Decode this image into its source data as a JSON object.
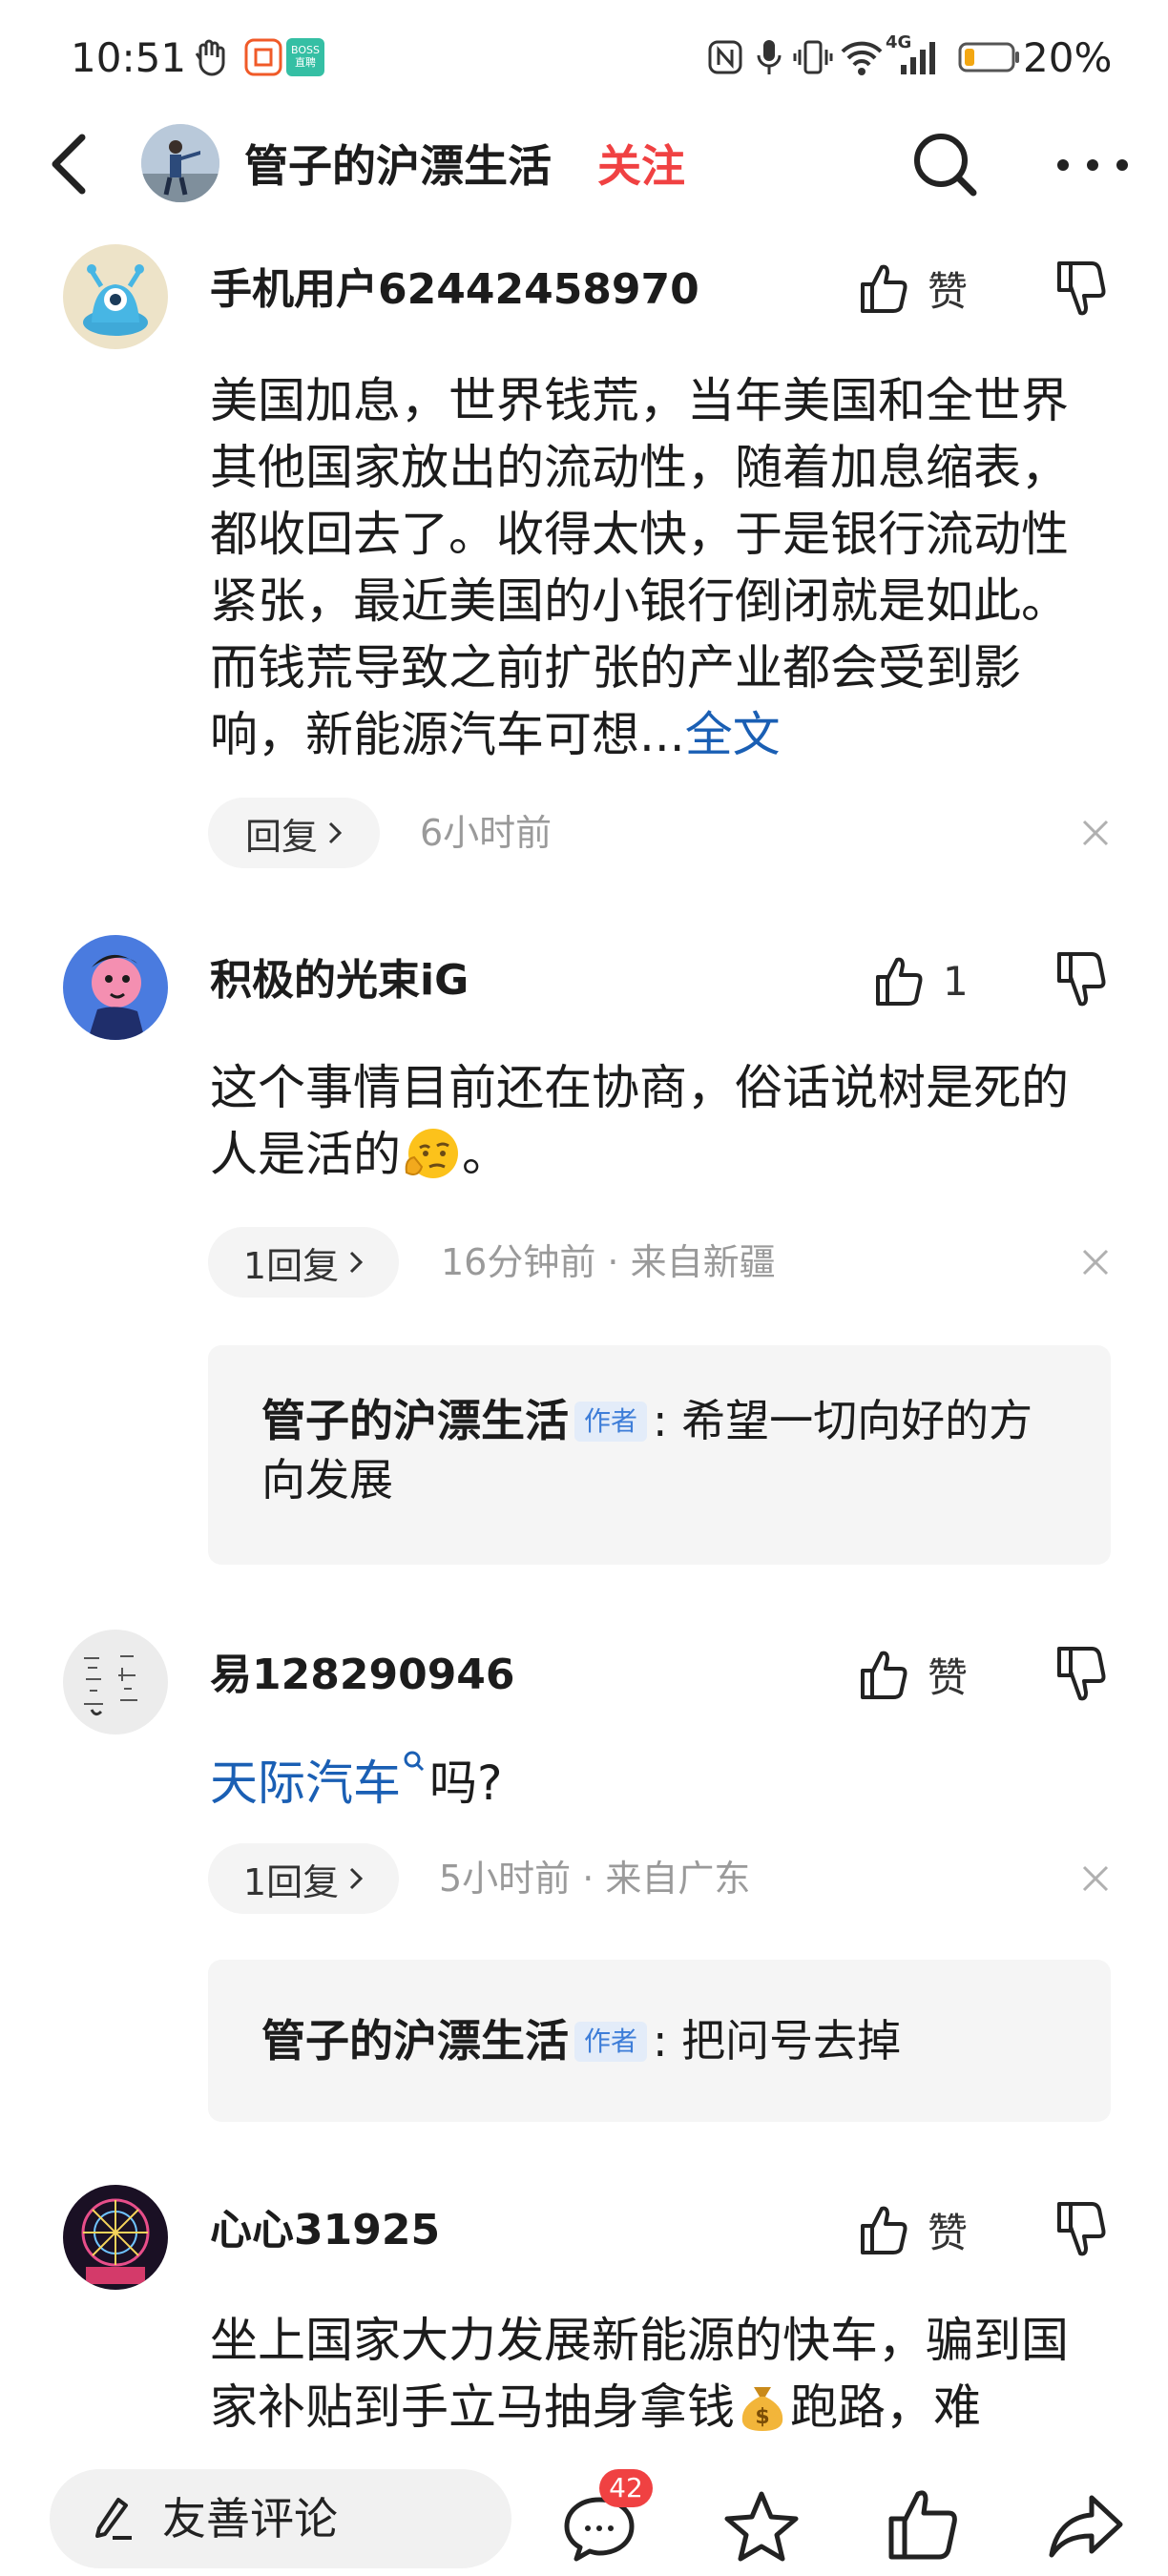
{
  "status_bar": {
    "time": "10:51",
    "icons": [
      "hand-icon",
      "dingding-icon",
      "boss-zhipin-icon",
      "nfc-icon",
      "mic-icon",
      "vibrate-icon",
      "wifi-icon",
      "signal-4g-icon",
      "battery-icon"
    ],
    "network": "4G",
    "battery": "20%",
    "boss_badge_top": "BOSS",
    "boss_badge_bottom": "直聘"
  },
  "header": {
    "title": "管子的沪漂生活",
    "follow_label": "关注"
  },
  "comments": [
    {
      "username": "手机用户62442458970",
      "like_label": "赞",
      "text": "美国加息，世界钱荒，当年美国和全世界其他国家放出的流动性，随着加息缩表，都收回去了。收得太快，于是银行流动性紧张，最近美国的小银行倒闭就是如此。而钱荒导致之前扩张的产业都会受到影响，新能源汽车可想...",
      "more_link": "全文",
      "reply_label": "回复",
      "meta": "6小时前"
    },
    {
      "username": "积极的光束iG",
      "like_label": "1",
      "text": "这个事情目前还在协商，俗话说树是死的人是活的",
      "text_end": "。",
      "reply_label": "1回复",
      "meta": "16分钟前 · 来自新疆",
      "reply": {
        "author": "管子的沪漂生活",
        "tag": "作者",
        "text": ": 希望一切向好的方向发展"
      }
    },
    {
      "username": "易128290946",
      "like_label": "赞",
      "text_link": "天际汽车",
      "text": "吗?",
      "reply_label": "1回复",
      "meta": "5小时前 · 来自广东",
      "reply": {
        "author": "管子的沪漂生活",
        "tag": "作者",
        "text": ": 把问号去掉"
      }
    },
    {
      "username": "心心31925",
      "like_label": "赞",
      "text": "坐上国家大力发展新能源的快车，骗到国家补贴到手立马抽身拿钱",
      "text_end": "跑路，难"
    }
  ],
  "bottom_bar": {
    "input_placeholder": "友善评论",
    "comment_count": "42"
  },
  "colors": {
    "accent_red": "#f04142",
    "link_blue": "#1a5fb4",
    "author_tag_blue": "#3d7dd8"
  }
}
